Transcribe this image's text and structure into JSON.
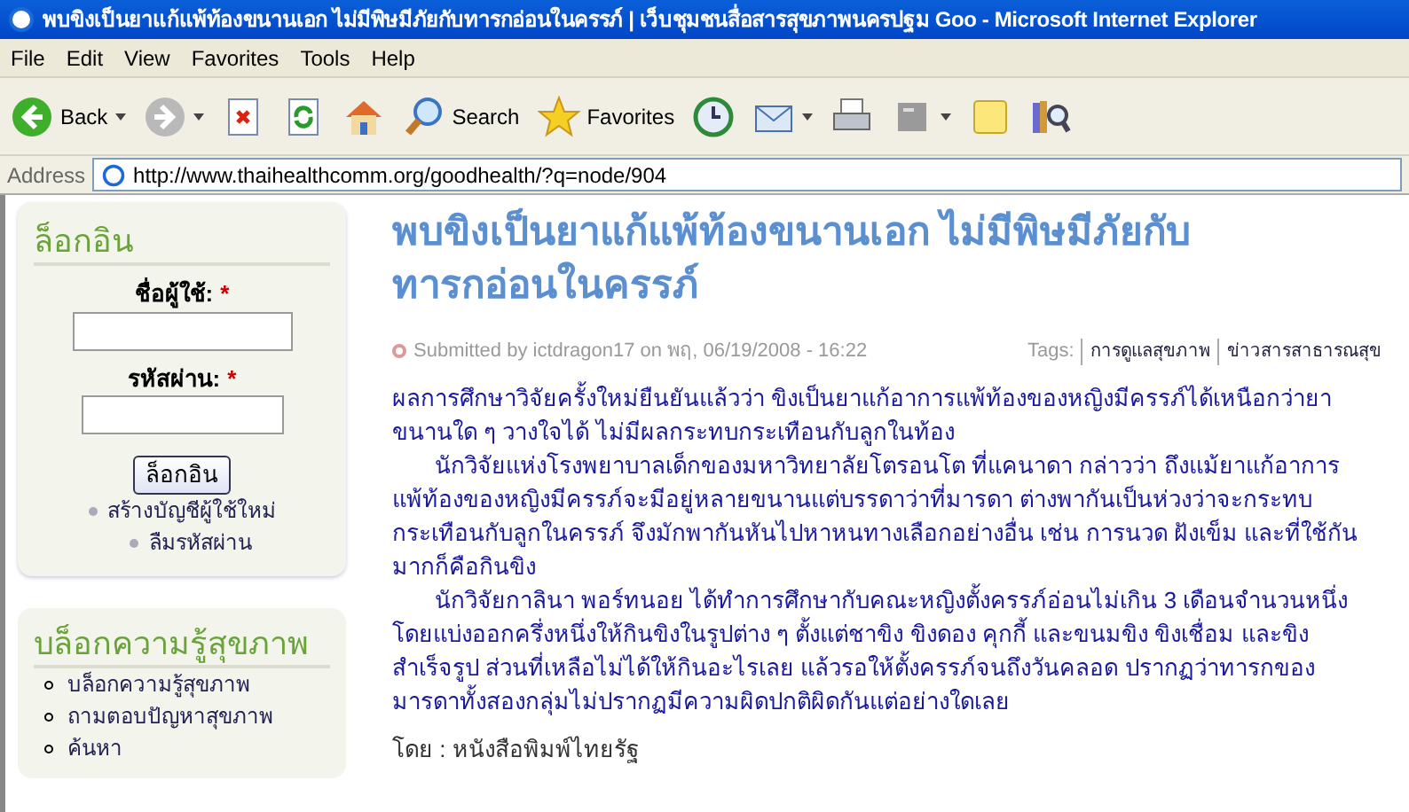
{
  "window": {
    "title": "พบขิงเป็นยาแก้แพ้ท้องขนานเอก ไม่มีพิษมีภัยกับทารกอ่อนในครรภ์ | เว็บชุมชนสื่อสารสุขภาพนครปฐม Goo - Microsoft Internet Explorer"
  },
  "menu": [
    "File",
    "Edit",
    "View",
    "Favorites",
    "Tools",
    "Help"
  ],
  "toolbar": [
    {
      "kind": "back",
      "label": "Back"
    },
    {
      "kind": "forward"
    },
    {
      "kind": "stop"
    },
    {
      "kind": "refresh"
    },
    {
      "kind": "home"
    },
    {
      "kind": "search",
      "label": "Search"
    },
    {
      "kind": "favorites",
      "label": "Favorites"
    },
    {
      "kind": "history"
    },
    {
      "kind": "mail"
    },
    {
      "kind": "print"
    },
    {
      "kind": "edit"
    },
    {
      "kind": "note"
    },
    {
      "kind": "research"
    }
  ],
  "address": {
    "label": "Address",
    "url": "http://www.thaihealthcomm.org/goodhealth/?q=node/904"
  },
  "login": {
    "title": "ล็อกอิน",
    "fields": [
      {
        "label": "ชื่อผู้ใช้:",
        "required": "*"
      },
      {
        "label": "รหัสผ่าน:",
        "required": "*"
      }
    ],
    "button": "ล็อกอิน",
    "links": [
      "สร้างบัญชีผู้ใช้ใหม่",
      "ลืมรหัสผ่าน"
    ]
  },
  "blog": {
    "title": "บล็อกความรู้สุขภาพ",
    "items": [
      "บล็อกความรู้สุขภาพ",
      "ถามตอบปัญหาสุขภาพ",
      "ค้นหา"
    ]
  },
  "article": {
    "title": "พบขิงเป็นยาแก้แพ้ท้องขนานเอก ไม่มีพิษมีภัยกับทารกอ่อนในครรภ์",
    "submitted": "Submitted by ictdragon17 on พฤ, 06/19/2008 - 16:22",
    "tags_label": "Tags:",
    "tags": [
      "การดูแลสุขภาพ",
      "ข่าวสารสาธารณสุข"
    ],
    "paragraphs": [
      {
        "indent": false,
        "text": "ผลการศึกษาวิจัยครั้งใหม่ยืนยันแล้วว่า ขิงเป็นยาแก้อาการแพ้ท้องของหญิงมีครรภ์ได้เหนือกว่ายาขนานใด ๆ วางใจได้ ไม่มีผลกระทบกระเทือนกับลูกในท้อง"
      },
      {
        "indent": true,
        "text": "นักวิจัยแห่งโรงพยาบาลเด็กของมหาวิทยาลัยโตรอนโต ที่แคนาดา กล่าวว่า ถึงแม้ยาแก้อาการแพ้ท้องของหญิงมีครรภ์จะมีอยู่หลายขนานแต่บรรดาว่าที่มารดา ต่างพากันเป็นห่วงว่าจะกระทบกระเทือนกับลูกในครรภ์ จึงมักพากันหันไปหาหนทางเลือกอย่างอื่น เช่น การนวด ฝังเข็ม และที่ใช้กันมากก็คือกินขิง"
      },
      {
        "indent": true,
        "text": "นักวิจัยกาลินา พอร์ทนอย ได้ทำการศึกษากับคณะหญิงตั้งครรภ์อ่อนไม่เกิน 3 เดือนจำนวนหนึ่ง โดยแบ่งออกครึ่งหนึ่งให้กินขิงในรูปต่าง ๆ ตั้งแต่ชาขิง ขิงดอง คุกกี้ และขนมขิง ขิงเชื่อม และขิงสำเร็จรูป ส่วนที่เหลือไม่ได้ให้กินอะไรเลย แล้วรอให้ตั้งครรภ์จนถึงวันคลอด ปรากฏว่าทารกของมารดาทั้งสองกลุ่มไม่ปรากฏมีความผิดปกติผิดกันแต่อย่างใดเลย"
      }
    ],
    "byline": "โดย : หนังสือพิมพ์ไทยรัฐ"
  }
}
